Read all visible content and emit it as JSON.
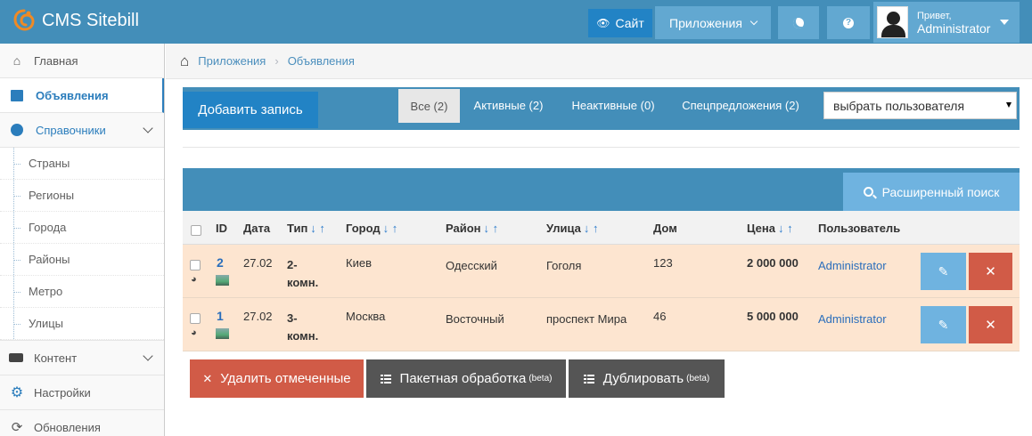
{
  "navbar": {
    "brand": "CMS Sitebill",
    "site_label": "Сайт",
    "apps_label": "Приложения",
    "user_greeting": "Привет,",
    "user_name": "Administrator"
  },
  "sidebar": {
    "items": [
      {
        "label": "Главная",
        "icon": "home-icon"
      },
      {
        "label": "Объявления",
        "icon": "book-icon"
      },
      {
        "label": "Справочники",
        "icon": "globe-icon"
      }
    ],
    "submenu": [
      "Страны",
      "Регионы",
      "Города",
      "Районы",
      "Метро",
      "Улицы"
    ],
    "items_after": [
      {
        "label": "Контент",
        "icon": "keyboard-icon"
      },
      {
        "label": "Настройки",
        "icon": "gear-icon"
      },
      {
        "label": "Обновления",
        "icon": "refresh-icon"
      }
    ]
  },
  "breadcrumb": {
    "item1": "Приложения",
    "item2": "Объявления"
  },
  "toolbar": {
    "add_label": "Добавить запись",
    "tabs": [
      "Все (2)",
      "Активные (2)",
      "Неактивные (0)",
      "Спецпредложения (2)"
    ],
    "user_select": "выбрать пользователя"
  },
  "search": {
    "label": "Расширенный поиск"
  },
  "table": {
    "headers": {
      "id": "ID",
      "date": "Дата",
      "type": "Тип",
      "city": "Город",
      "district": "Район",
      "street": "Улица",
      "house": "Дом",
      "price": "Цена",
      "user": "Пользователь"
    },
    "sort_arrows": "↓ ↑",
    "rows": [
      {
        "id": "2",
        "date": "27.02",
        "type_line1": "2-",
        "type_line2": "комн.",
        "city": "Киев",
        "district": "Одесский",
        "street": "Гоголя",
        "house": "123",
        "price": "2 000 000",
        "user": "Administrator"
      },
      {
        "id": "1",
        "date": "27.02",
        "type_line1": "3-",
        "type_line2": "комн.",
        "city": "Москва",
        "district": "Восточный",
        "street": "проспект Мира",
        "house": "46",
        "price": "5 000 000",
        "user": "Administrator"
      }
    ]
  },
  "bottom": {
    "delete_label": "Удалить отмеченные",
    "batch_label": "Пакетная обработка",
    "duplicate_label": "Дублировать",
    "beta": "(beta)"
  },
  "colors": {
    "navbar": "#438eb9",
    "accent": "#2283c5",
    "row_highlight": "#fde5d0",
    "danger": "#d15b47"
  }
}
